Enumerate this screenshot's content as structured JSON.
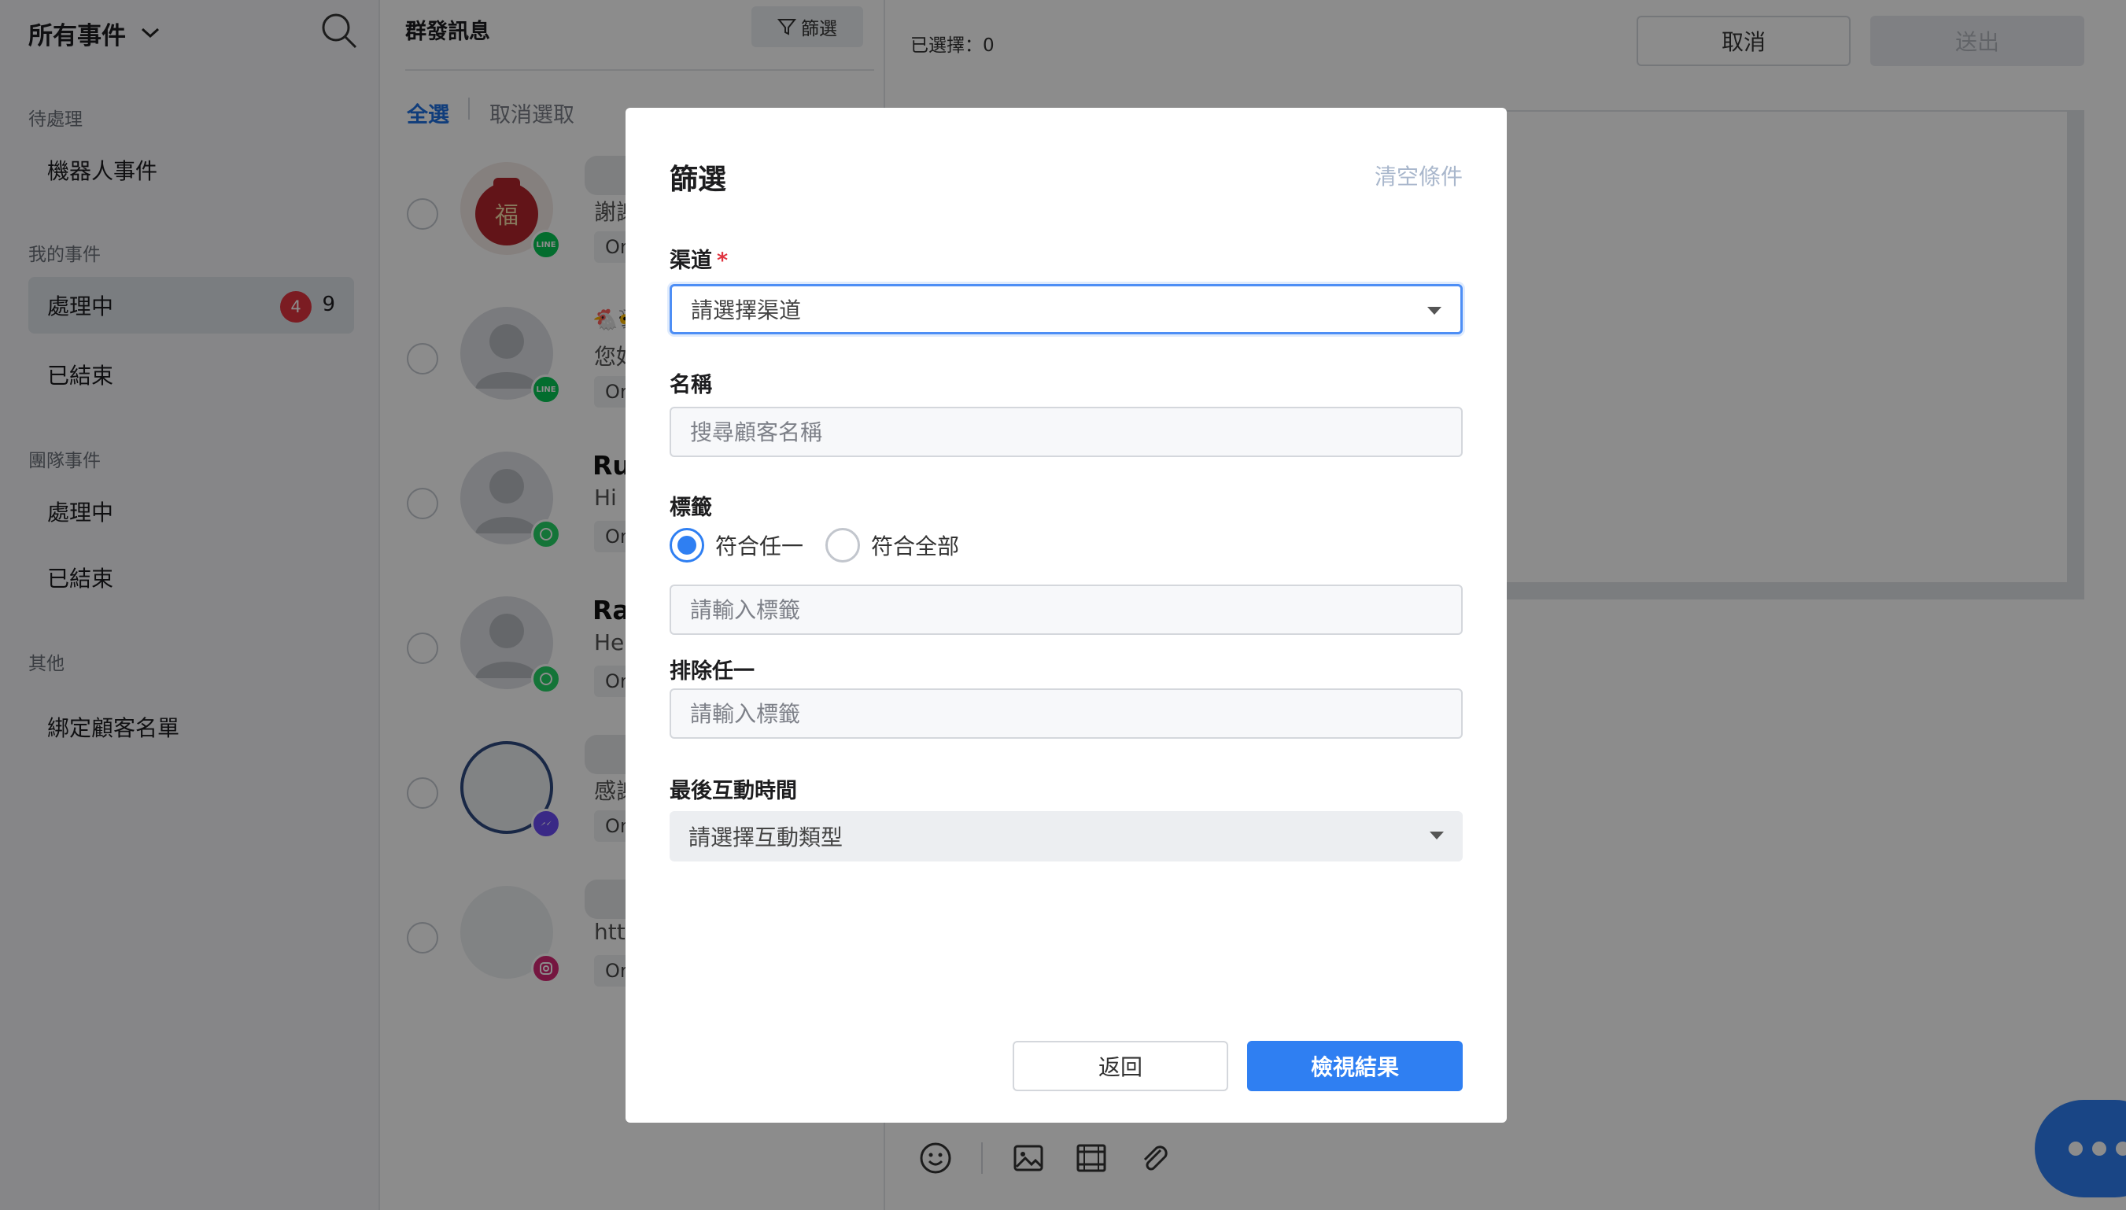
{
  "sidebar": {
    "title": "所有事件",
    "sections": {
      "pending": "待處理",
      "mine": "我的事件",
      "team": "團隊事件",
      "other": "其他"
    },
    "items": {
      "bot_events": "機器人事件",
      "my_in_progress": "處理中",
      "my_in_progress_badge": "4",
      "my_in_progress_count": "9",
      "my_closed": "已結束",
      "team_in_progress": "處理中",
      "team_closed": "已結束",
      "bind_customers": "綁定顧客名單"
    }
  },
  "list": {
    "title": "群發訊息",
    "filter_label": "篩選",
    "select_all": "全選",
    "deselect": "取消選取",
    "rows": [
      {
        "name": "",
        "preview": "謝謝",
        "tag": "Omn",
        "channel": "line"
      },
      {
        "name": "",
        "preview": "您好，",
        "tag": "Omn",
        "channel": "line"
      },
      {
        "name": "Ruby",
        "preview": "Hi Ru",
        "tag": "Omn",
        "channel": "whatsapp"
      },
      {
        "name": "Rasy",
        "preview": "Hello",
        "tag": "Omn",
        "channel": "whatsapp"
      },
      {
        "name": "",
        "preview": "感謝您",
        "tag": "Omn",
        "channel": "messenger"
      },
      {
        "name": "",
        "preview": "https:",
        "tag": "Omn",
        "channel": "instagram"
      }
    ]
  },
  "main": {
    "selected_count": "已選擇：0",
    "cancel": "取消",
    "send": "送出"
  },
  "modal": {
    "title": "篩選",
    "clear": "清空條件",
    "channel_label": "渠道",
    "required_mark": "*",
    "channel_placeholder": "請選擇渠道",
    "name_label": "名稱",
    "name_placeholder": "搜尋顧客名稱",
    "tag_label": "標籤",
    "match_any": "符合任一",
    "match_all": "符合全部",
    "tag_placeholder": "請輸入標籤",
    "exclude_label": "排除任一",
    "exclude_placeholder": "請輸入標籤",
    "last_interaction_label": "最後互動時間",
    "interaction_placeholder": "請選擇互動類型",
    "back": "返回",
    "view_results": "檢視結果"
  },
  "colors": {
    "accent": "#2f7ff2",
    "badge": "#e0333f",
    "line": "#06c755",
    "whatsapp": "#25d366",
    "messenger": "#6b4cf5",
    "instagram": "#d62976"
  }
}
